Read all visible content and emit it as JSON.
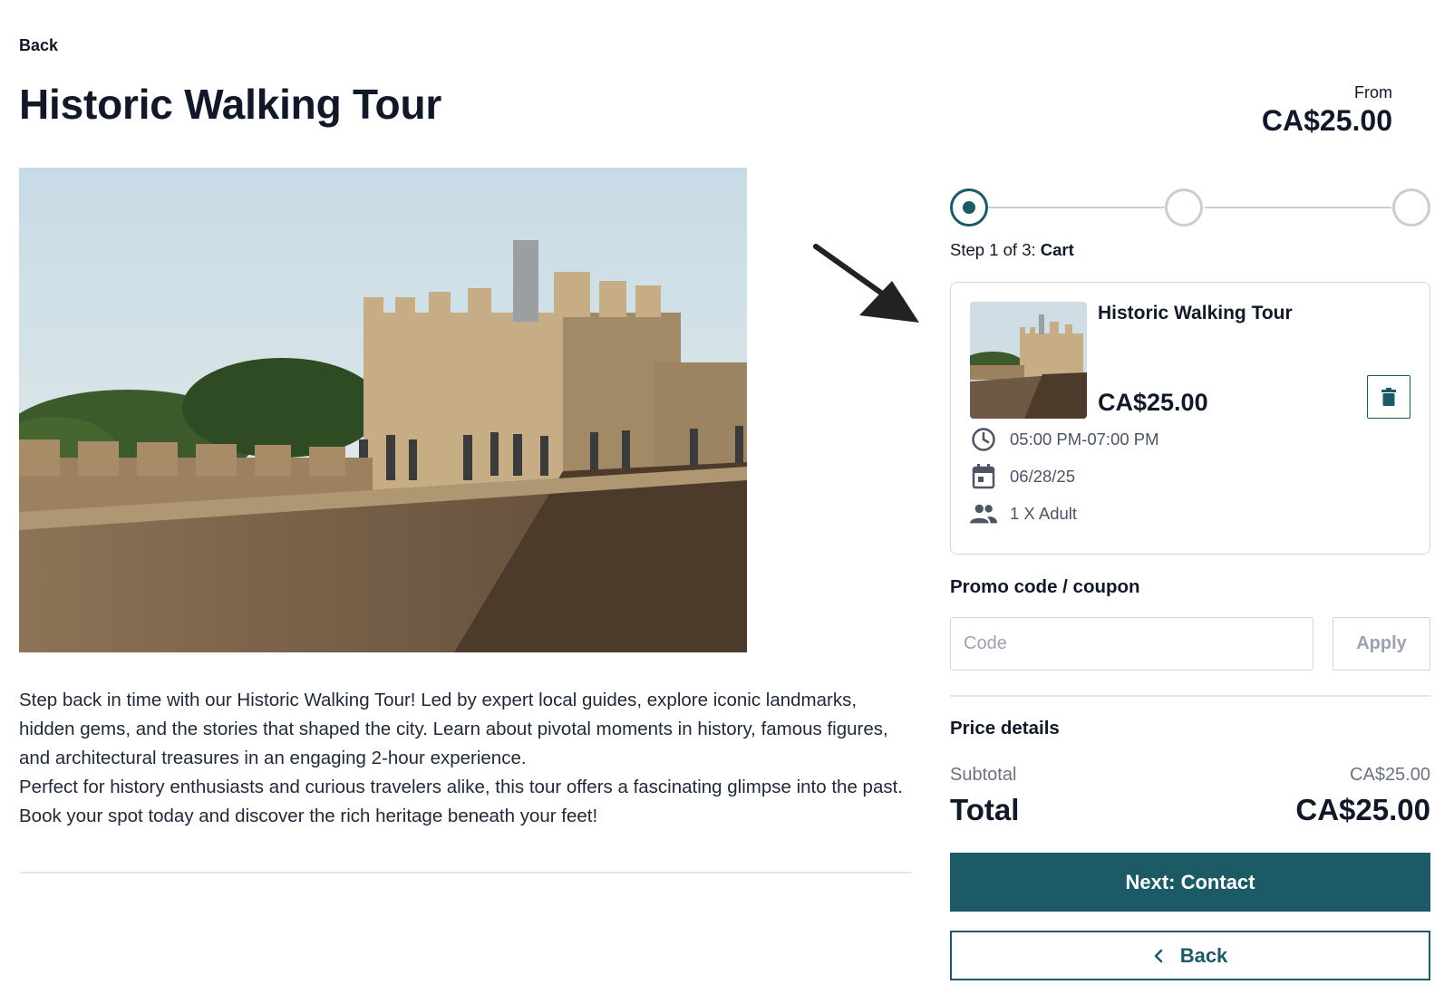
{
  "header": {
    "back_label": "Back",
    "title": "Historic Walking Tour",
    "from_label": "From",
    "from_price": "CA$25.00"
  },
  "description": {
    "paragraph_1": "Step back in time with our Historic Walking Tour! Led by expert local guides, explore iconic landmarks, hidden gems, and the stories that shaped the city. Learn about pivotal moments in history, famous figures, and architectural treasures in an engaging 2-hour experience.",
    "paragraph_2": "Perfect for history enthusiasts and curious travelers alike, this tour offers a fascinating glimpse into the past. Book your spot today and discover the rich heritage beneath your feet!"
  },
  "stepper": {
    "current_step": 1,
    "total_steps": 3,
    "label_prefix": "Step 1 of 3:",
    "label_current": "Cart"
  },
  "cart": {
    "item_title": "Historic Walking Tour",
    "item_price": "CA$25.00",
    "time": "05:00 PM-07:00 PM",
    "date": "06/28/25",
    "guests": "1 X Adult",
    "icons": [
      "clock-icon",
      "calendar-icon",
      "people-icon",
      "trash-icon"
    ]
  },
  "promo": {
    "label": "Promo code / coupon",
    "input_value": "",
    "placeholder": "Code",
    "apply_label": "Apply"
  },
  "price_details": {
    "heading": "Price details",
    "subtotal_label": "Subtotal",
    "subtotal_value": "CA$25.00",
    "total_label": "Total",
    "total_value": "CA$25.00"
  },
  "actions": {
    "next_label": "Next: Contact",
    "back_label": "Back"
  },
  "colors": {
    "accent": "#1c5a66",
    "text": "#111827",
    "muted": "#6b7280",
    "border": "#d1d5db"
  }
}
